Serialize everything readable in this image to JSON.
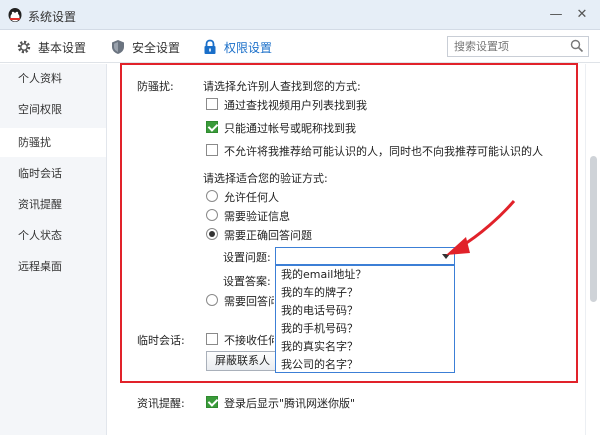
{
  "window": {
    "title": "系统设置"
  },
  "tabs": [
    {
      "label": "基本设置",
      "icon": "gear-icon"
    },
    {
      "label": "安全设置",
      "icon": "shield-icon"
    },
    {
      "label": "权限设置",
      "icon": "lock-icon",
      "active": true
    }
  ],
  "search": {
    "placeholder": "搜索设置项"
  },
  "sidebar": {
    "items": [
      {
        "label": "个人资料"
      },
      {
        "label": "空间权限"
      },
      {
        "label": "防骚扰",
        "active": true
      },
      {
        "label": "临时会话"
      },
      {
        "label": "资讯提醒"
      },
      {
        "label": "个人状态"
      },
      {
        "label": "远程桌面"
      }
    ]
  },
  "anti_harass": {
    "section_label": "防骚扰:",
    "find_prompt": "请选择允许别人查找到您的方式:",
    "find_options": [
      {
        "label": "通过查找视频用户列表找到我",
        "checked": false
      },
      {
        "label": "只能通过帐号或昵称找到我",
        "checked": true
      },
      {
        "label": "不允许将我推荐给可能认识的人，同时也不向我推荐可能认识的人",
        "checked": false
      }
    ],
    "verify_prompt": "请选择适合您的验证方式:",
    "verify_options": [
      {
        "label": "允许任何人",
        "checked": false
      },
      {
        "label": "需要验证信息",
        "checked": false
      },
      {
        "label": "需要正确回答问题",
        "checked": true
      },
      {
        "label": "需要回答问题",
        "checked": false
      }
    ],
    "question_label": "设置问题:",
    "answer_label": "设置答案:",
    "question_value": "",
    "question_options": [
      "我的email地址？",
      "我的车的牌子？",
      "我的电话号码？",
      "我的手机号码？",
      "我的真实名字？",
      "我公司的名字？"
    ]
  },
  "temp_session": {
    "section_label": "临时会话:",
    "option": {
      "label": "不接收任何临时会话消息",
      "checked": false
    },
    "button_label": "屏蔽联系人管理"
  },
  "news": {
    "section_label": "资讯提醒:",
    "option": {
      "label": "登录后显示\"腾讯网迷你版\"",
      "checked": true
    }
  },
  "colors": {
    "highlight_box": "#e1222a",
    "accent": "#1a6fc9",
    "check": "#3a9b3a"
  }
}
